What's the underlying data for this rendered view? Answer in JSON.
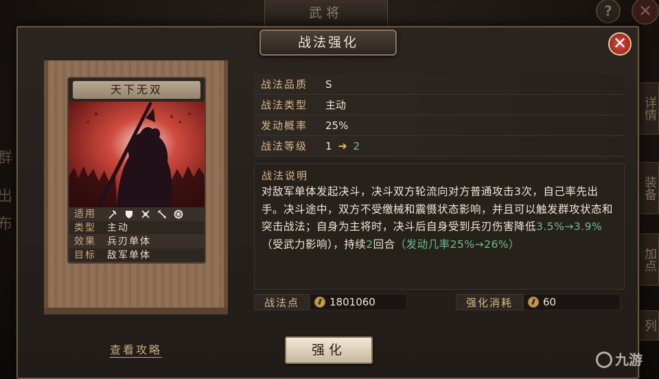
{
  "background": {
    "title": "武将",
    "help_label": "?",
    "close_label": "✕",
    "side_tabs": [
      "详情",
      "装备",
      "加点",
      "列"
    ],
    "left_chars": [
      "群",
      "出",
      "布"
    ]
  },
  "dialog": {
    "title": "战法强化",
    "close_label": "✕"
  },
  "card": {
    "name": "天下无双",
    "attributes": [
      {
        "key": "适用",
        "value": "",
        "icons": [
          "axe-icon",
          "shield-icon",
          "crossbow-icon",
          "spear-icon",
          "wheel-icon"
        ]
      },
      {
        "key": "类型",
        "value": "主动"
      },
      {
        "key": "效果",
        "value": "兵刃单体"
      },
      {
        "key": "目标",
        "value": "敌军单体"
      }
    ]
  },
  "info": {
    "rows": [
      {
        "key": "战法品质",
        "value": "S"
      },
      {
        "key": "战法类型",
        "value": "主动"
      },
      {
        "key": "发动概率",
        "value": "25%"
      }
    ],
    "level": {
      "key": "战法等级",
      "from": "1",
      "to": "2"
    },
    "description": {
      "title": "战法说明",
      "text_a": "对敌军单体发起决斗，决斗双方轮流向对方普通攻击3次，自己率先出手。决斗途中，双方不受缴械和震慑状态影响，并且可以触发群攻状态和突击战法；自身为主将时，决斗后自身受到兵刃伤害降低",
      "hl_a": "3.5%→3.9%",
      "text_b": "（受武力影响），持续",
      "hl_b": "2",
      "text_c": "回合",
      "hl_c": "（发动几率25%→26%）"
    }
  },
  "resources": {
    "points_label": "战法点",
    "points_value": "1801060",
    "cost_label": "强化消耗",
    "cost_value": "60"
  },
  "guide_link": "查看攻略",
  "enhance_button": "强化",
  "brand": "九游",
  "colors": {
    "accent_gold": "#d8b98c",
    "highlight_green": "#6dbd8c",
    "close_red": "#d64a3a"
  }
}
